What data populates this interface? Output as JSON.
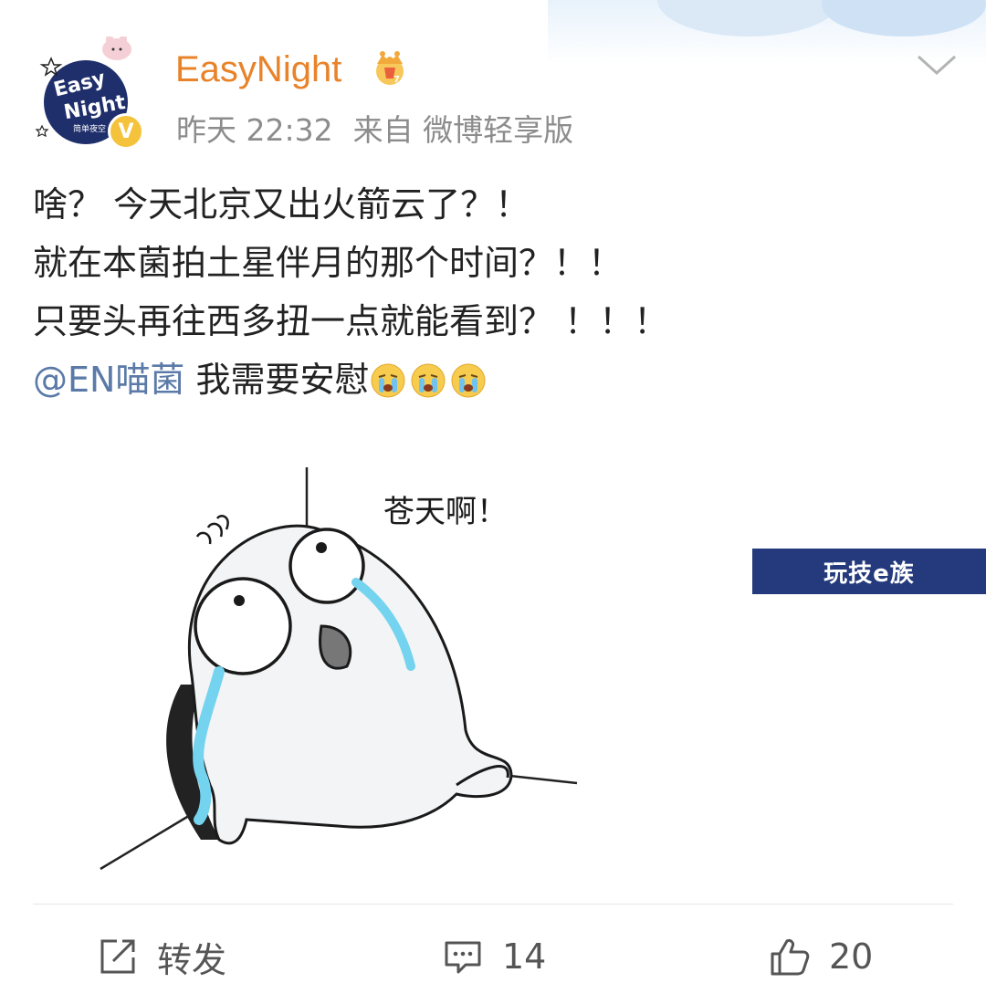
{
  "post": {
    "author": {
      "name": "EasyNight",
      "avatar_icon": "easy-night-logo",
      "badge_icon": "verified-v-icon",
      "vip_icon": "crown-icon"
    },
    "meta": {
      "time": "昨天 22:32",
      "source": "来自 微博轻享版"
    },
    "text_lines": [
      "啥？ 今天北京又出火箭云了？！",
      "就在本菌拍土星伴月的那个时间？！！",
      "只要头再往西多扭一点就能看到？ ！！！"
    ],
    "mention": "@EN喵菌",
    "mention_tail": "我需要安慰",
    "emojis": [
      "crying-emoji",
      "crying-emoji",
      "crying-emoji"
    ],
    "image": {
      "caption_text": "苍天啊！"
    },
    "watermark": "玩技e族",
    "actions": {
      "repost_label": "转发",
      "comment_count": "14",
      "like_count": "20"
    }
  },
  "colors": {
    "username": "#e8832a",
    "mention": "#5b7aa8",
    "meta": "#8c8c8c",
    "watermark_bg": "#243a7c"
  }
}
